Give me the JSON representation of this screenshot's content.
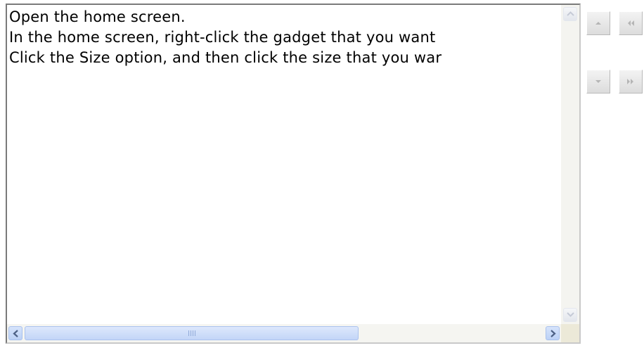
{
  "text_lines": [
    "Open the home screen.",
    "In the home screen, right-click the gadget that you want",
    "Click the Size option, and then click the size that you war"
  ],
  "icons": {
    "scroll_up": "arrow-up-icon",
    "scroll_down": "arrow-down-icon",
    "scroll_left": "arrow-left-icon",
    "scroll_right": "arrow-right-icon",
    "move_up": "triangle-up-icon",
    "move_down": "triangle-down-icon",
    "move_top": "double-chevron-left-icon",
    "move_bottom": "double-chevron-right-icon"
  },
  "colors": {
    "scrollbar_accent": "#c3d5f7",
    "arrow_blue": "#4d6185",
    "nav_glyph": "#b5b5b5"
  }
}
